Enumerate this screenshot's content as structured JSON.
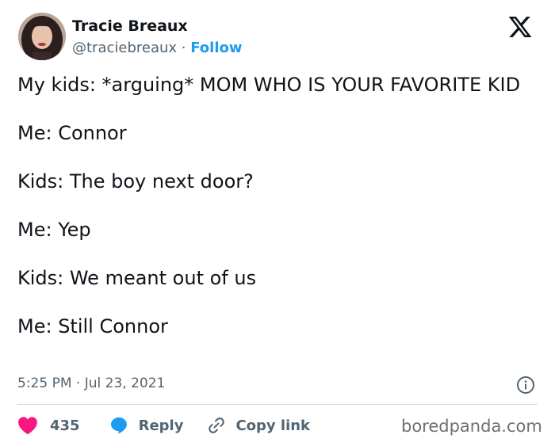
{
  "author": {
    "name": "Tracie Breaux",
    "handle": "@traciebreaux",
    "separator": " · ",
    "follow_label": "Follow"
  },
  "tweet": {
    "text": "My kids: *arguing* MOM WHO IS YOUR FAVORITE KID\n\nMe: Connor\n\nKids: The boy next door?\n\nMe: Yep\n\nKids: We meant out of us\n\nMe: Still Connor",
    "timestamp": "5:25 PM · Jul 23, 2021"
  },
  "actions": {
    "like_count": "435",
    "reply_label": "Reply",
    "copy_link_label": "Copy link"
  },
  "icons": {
    "platform": "x-logo-icon",
    "info": "info-icon",
    "like": "heart-icon",
    "reply": "reply-bubble-icon",
    "copy": "link-icon"
  },
  "colors": {
    "accent": "#1d9bf0",
    "heart": "#f91880",
    "secondary_text": "#536471"
  },
  "watermark": "boredpanda.com"
}
